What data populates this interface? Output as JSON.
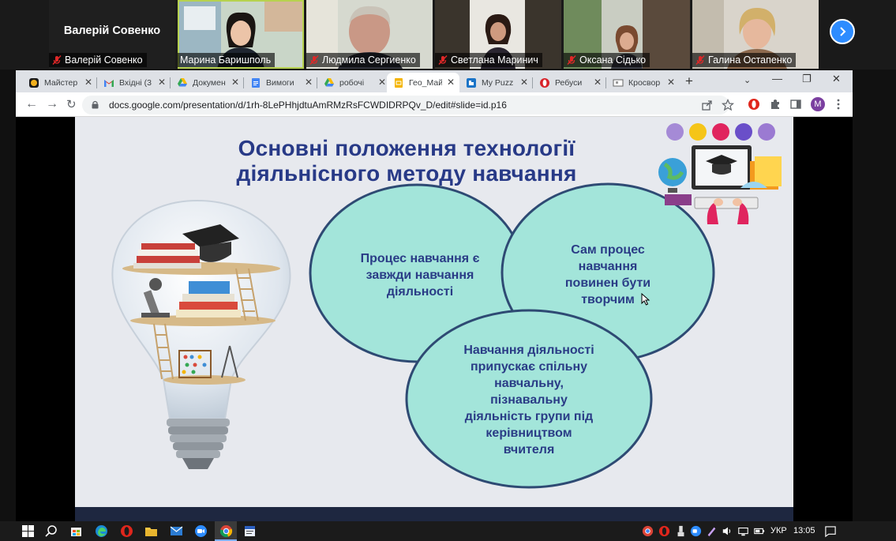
{
  "participants": [
    {
      "name": "Валерій Совенко",
      "display": "Валерій Совенко",
      "muted": true,
      "video": false
    },
    {
      "name": "Марина Баришполь",
      "muted": false,
      "video": true,
      "speaking": true
    },
    {
      "name": "Людмила Сергиенко",
      "muted": true,
      "video": true
    },
    {
      "name": "Светлана Маринич",
      "muted": true,
      "video": true
    },
    {
      "name": "Оксана Сідько",
      "muted": true,
      "video": true
    },
    {
      "name": "Галина Остапенко",
      "muted": true,
      "video": true
    }
  ],
  "browser": {
    "tabs": [
      {
        "title": "Майстер",
        "icon": "yellow-app-icon"
      },
      {
        "title": "Вхідні (3",
        "icon": "gmail-icon"
      },
      {
        "title": "Докумен",
        "icon": "google-drive-icon"
      },
      {
        "title": "Вимоги",
        "icon": "google-docs-icon"
      },
      {
        "title": "робочі",
        "icon": "google-drive-icon"
      },
      {
        "title": "Гео_Май",
        "icon": "google-slides-icon",
        "active": true
      },
      {
        "title": "My Puzz",
        "icon": "puzzle-icon"
      },
      {
        "title": "Ребуси",
        "icon": "opera-icon"
      },
      {
        "title": "Кросвор",
        "icon": "crossword-icon"
      }
    ],
    "url": "docs.google.com/presentation/d/1rh-8LePHhjdtuAmRMzRsFCWDIDRPQv_D/edit#slide=id.p16",
    "profile_initial": "M"
  },
  "slide": {
    "title_line1": "Основні положення технології",
    "title_line2": "діяльнісного методу навчання",
    "bubble1": [
      "Процес навчання є",
      "завжди навчання",
      "діяльності"
    ],
    "bubble2": [
      "Сам процес",
      "навчання",
      "повинен бути",
      "творчим"
    ],
    "bubble3": [
      "Навчання діяльності",
      "припускає спільну",
      "навчальну,",
      "пізнавальну",
      "діяльність групи під",
      "керівництвом",
      "вчителя"
    ],
    "colors": {
      "bubble_fill": "#a3e5da",
      "bubble_stroke": "#2e4a73",
      "title": "#283a87",
      "slide_bg": "#e7e9ee"
    }
  },
  "taskbar": {
    "language": "УКР",
    "time": "13:05"
  }
}
